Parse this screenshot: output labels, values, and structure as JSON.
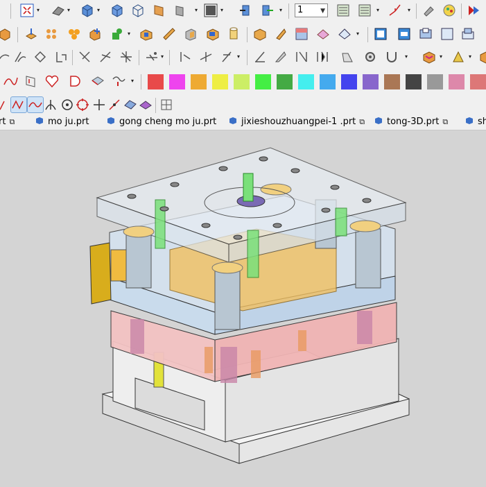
{
  "toolbar": {
    "row1": {
      "zoom_box_label": "1",
      "icons": [
        "fit-view-icon",
        "shading-mode-icon",
        "solid-box-icon",
        "solid-box-2-icon",
        "wireframe-box-icon",
        "section-icon",
        "rotate-icon",
        "display-mode-icon",
        "insert-part-icon",
        "move-part-icon",
        "layer-icon",
        "layer-2-icon",
        "axis-icon",
        "paint-icon",
        "color-picker-icon",
        "run-icon"
      ]
    },
    "row2": {
      "icons": [
        "box-icon",
        "extrude-icon",
        "pattern-icon",
        "boolean-icon",
        "add-icon",
        "cube-icon",
        "fillet-icon",
        "shell-icon",
        "cylinder-icon",
        "shaded-box-icon",
        "texture-box-icon",
        "tetra-icon",
        "wire-box-icon",
        "grid-icon",
        "save-icon",
        "mold-icon",
        "block-icon",
        "block-2-icon"
      ]
    },
    "row3": {
      "icons": [
        "curve-icon",
        "loft-icon",
        "sweep-icon",
        "offset-icon",
        "trim-icon",
        "split-icon",
        "blend-icon",
        "distance-icon",
        "angle-icon",
        "measure-icon",
        "clearance-icon",
        "check-icon",
        "analysis-icon",
        "component-icon",
        "assembly-icon",
        "explode-icon"
      ]
    },
    "row4": {
      "icons": [
        "spline-icon",
        "surface-icon",
        "heart-surface-icon",
        "d-surface-icon",
        "patch-icon",
        "curve-tool-icon"
      ],
      "colors": [
        "#e84a4a",
        "#ee44ee",
        "#eeaa33",
        "#eeee44",
        "#ccee66",
        "#44ee44",
        "#44aa44",
        "#44eeee",
        "#44aaee",
        "#4444ee",
        "#8866cc",
        "#aa7755",
        "#444444",
        "#999999",
        "#dd88aa",
        "#dd7777"
      ]
    },
    "row5": {
      "icons": [
        "point-icon",
        "line-snap-icon",
        "curve-snap-icon",
        "intersect-icon",
        "center-icon",
        "quadrant-icon",
        "crosshair-icon",
        "line-icon",
        "view-icon",
        "material-icon",
        "grid-view-icon"
      ]
    }
  },
  "tabs": [
    {
      "label": "rt"
    },
    {
      "label": "mo ju.prt"
    },
    {
      "label": "gong cheng mo ju.prt"
    },
    {
      "label": "jixieshouzhuangpei-1 .prt"
    },
    {
      "label": "tong-3D.prt"
    },
    {
      "label": "sh"
    }
  ],
  "viewport": {
    "background": "#d4d4d4"
  }
}
